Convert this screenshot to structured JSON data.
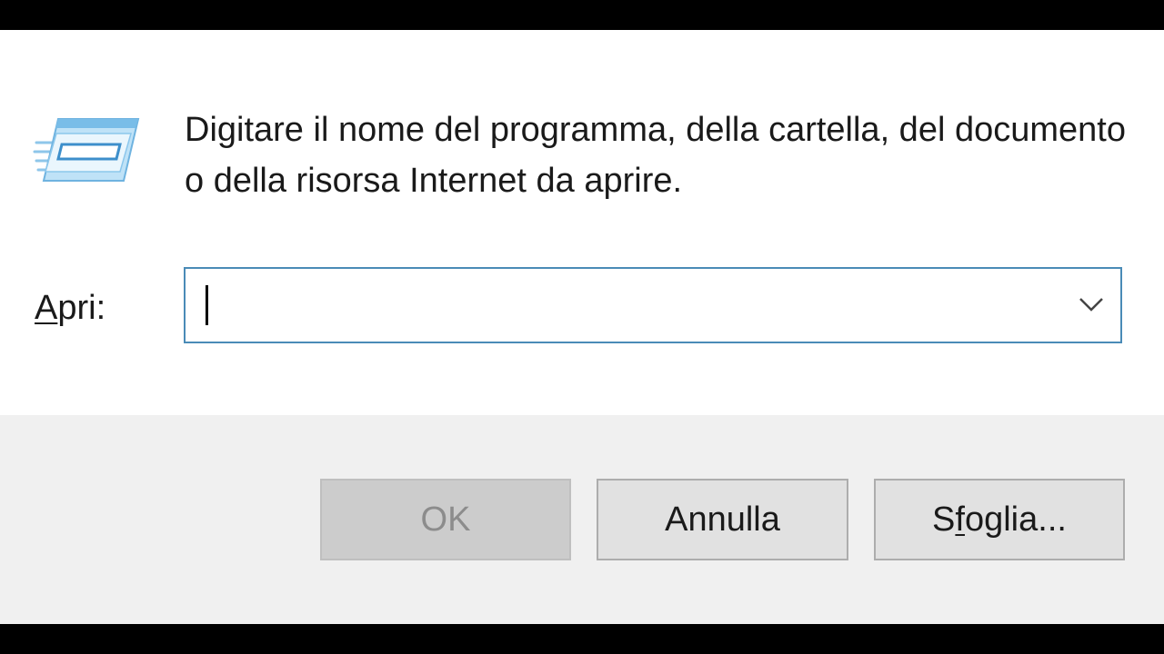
{
  "dialog": {
    "description": "Digitare il nome del programma, della cartella, del documento o della risorsa Internet da aprire.",
    "icon": "run-icon"
  },
  "open_field": {
    "label_mnemonic": "A",
    "label_rest": "pri:",
    "value": "",
    "dropdown_icon": "chevron-down-icon"
  },
  "buttons": {
    "ok_label": "OK",
    "ok_enabled": false,
    "cancel_label": "Annulla",
    "browse_prefix": "S",
    "browse_mnemonic": "f",
    "browse_rest": "oglia..."
  },
  "colors": {
    "accent_border": "#4a8bb7",
    "button_bar": "#f0f0f0",
    "disabled_text": "#8c8c8c"
  }
}
